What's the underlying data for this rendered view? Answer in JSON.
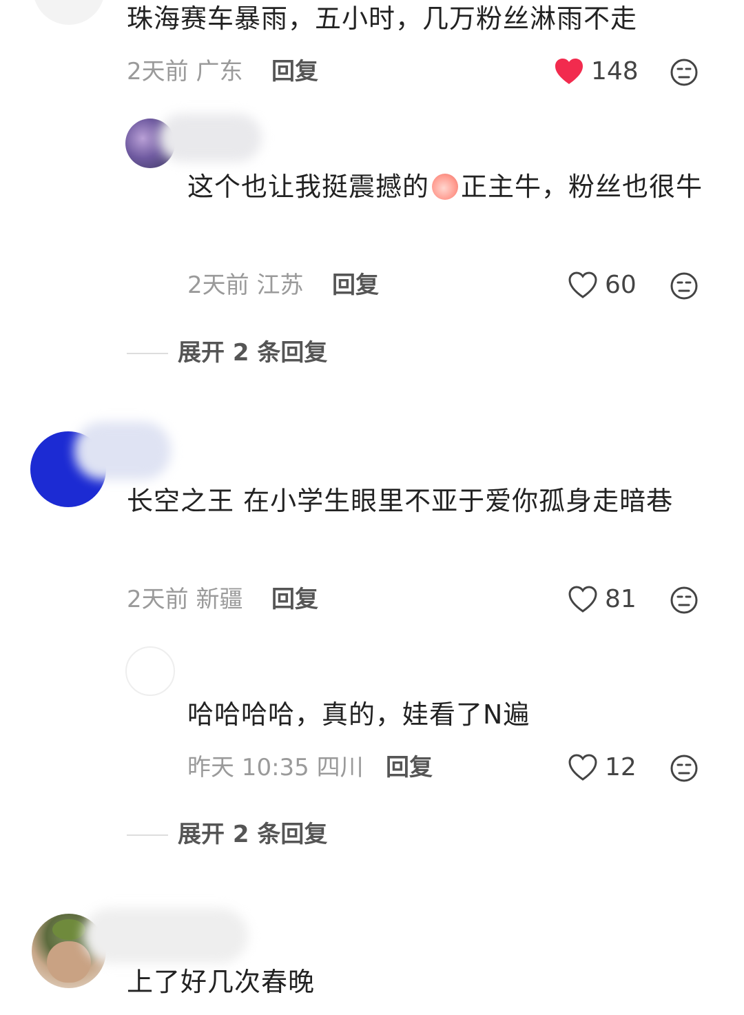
{
  "colors": {
    "liked_heart": "#f22b4e",
    "meta_gray": "#9a9a9a",
    "avatar_blue": "#1c2bd3"
  },
  "comments": [
    {
      "text": "珠海赛车暴雨，五小时，几万粉丝淋雨不走",
      "time_location": "2天前 广东",
      "reply_label": "回复",
      "likes": "148",
      "liked": true,
      "replies": [
        {
          "text_a": "这个也让我挺震撼的",
          "emoji": "thumbs-up-emoji",
          "text_b": "正主牛，粉丝也很牛",
          "time_location": "2天前 江苏",
          "reply_label": "回复",
          "likes": "60"
        }
      ],
      "expand_label": "展开 2 条回复"
    },
    {
      "text": "长空之王 在小学生眼里不亚于爱你孤身走暗巷",
      "time_location": "2天前 新疆",
      "reply_label": "回复",
      "likes": "81",
      "replies": [
        {
          "text": "哈哈哈哈，真的，娃看了N遍",
          "time_location": "昨天 10:35 四川",
          "reply_label": "回复",
          "likes": "12"
        }
      ],
      "expand_label": "展开 2 条回复"
    },
    {
      "text": "上了好几次春晚"
    }
  ]
}
